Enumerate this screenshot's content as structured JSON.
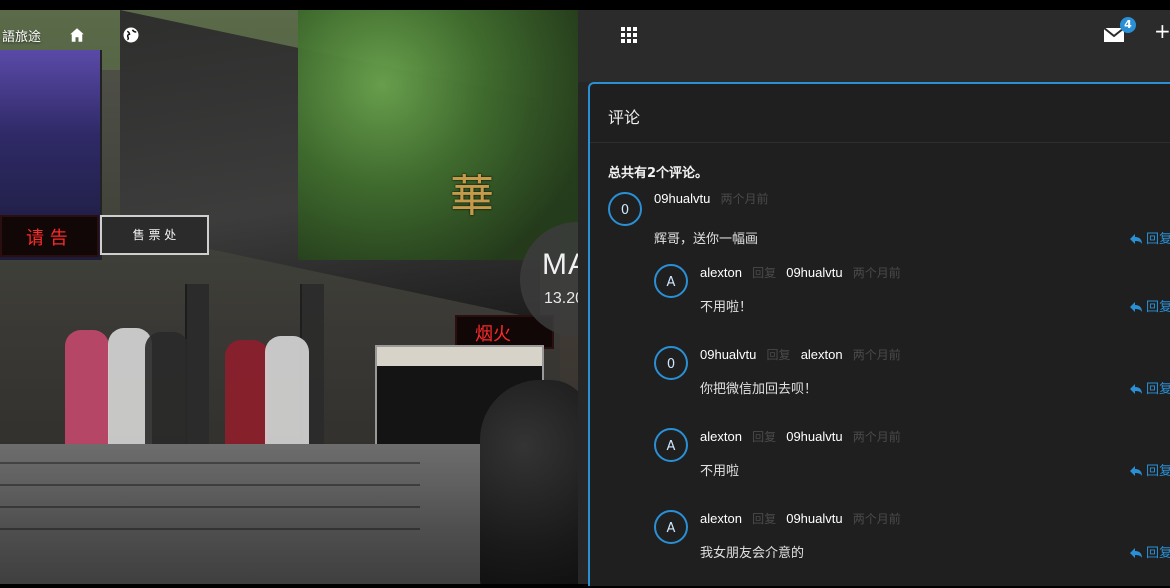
{
  "nav": {
    "brand": "語旅途",
    "icons": [
      "home-icon",
      "globe-icon"
    ]
  },
  "photo": {
    "ticket_sign": "售 票 处",
    "big_sign_char": "華",
    "led_left": "请 告",
    "led_right": "烟火"
  },
  "date_badge": {
    "month": "MA",
    "day": "13.20"
  },
  "topbar": {
    "grid_icon": "grid-icon",
    "mail_icon": "envelope-icon",
    "mail_count": "4",
    "plus_icon": "plus-icon"
  },
  "comments_panel": {
    "title": "评论",
    "total_text": "总共有2个评论。",
    "reply_action": "回复",
    "reply_verb": "回复",
    "comments": [
      {
        "avatar": "0",
        "user": "09hualvtu",
        "time": "两个月前",
        "text": "辉哥，送你一幅画"
      },
      {
        "avatar": "A",
        "user": "alexton",
        "to": "09hualvtu",
        "time": "两个月前",
        "text": "不用啦！"
      },
      {
        "avatar": "0",
        "user": "09hualvtu",
        "to": "alexton",
        "time": "两个月前",
        "text": "你把微信加回去呗！"
      },
      {
        "avatar": "A",
        "user": "alexton",
        "to": "09hualvtu",
        "time": "两个月前",
        "text": "不用啦"
      },
      {
        "avatar": "A",
        "user": "alexton",
        "to": "09hualvtu",
        "time": "两个月前",
        "text": "我女朋友会介意的"
      }
    ]
  },
  "colors": {
    "accent": "#2a90d6",
    "panel_bg": "#1f1f1f",
    "topbar_bg": "#2b2b2b"
  }
}
